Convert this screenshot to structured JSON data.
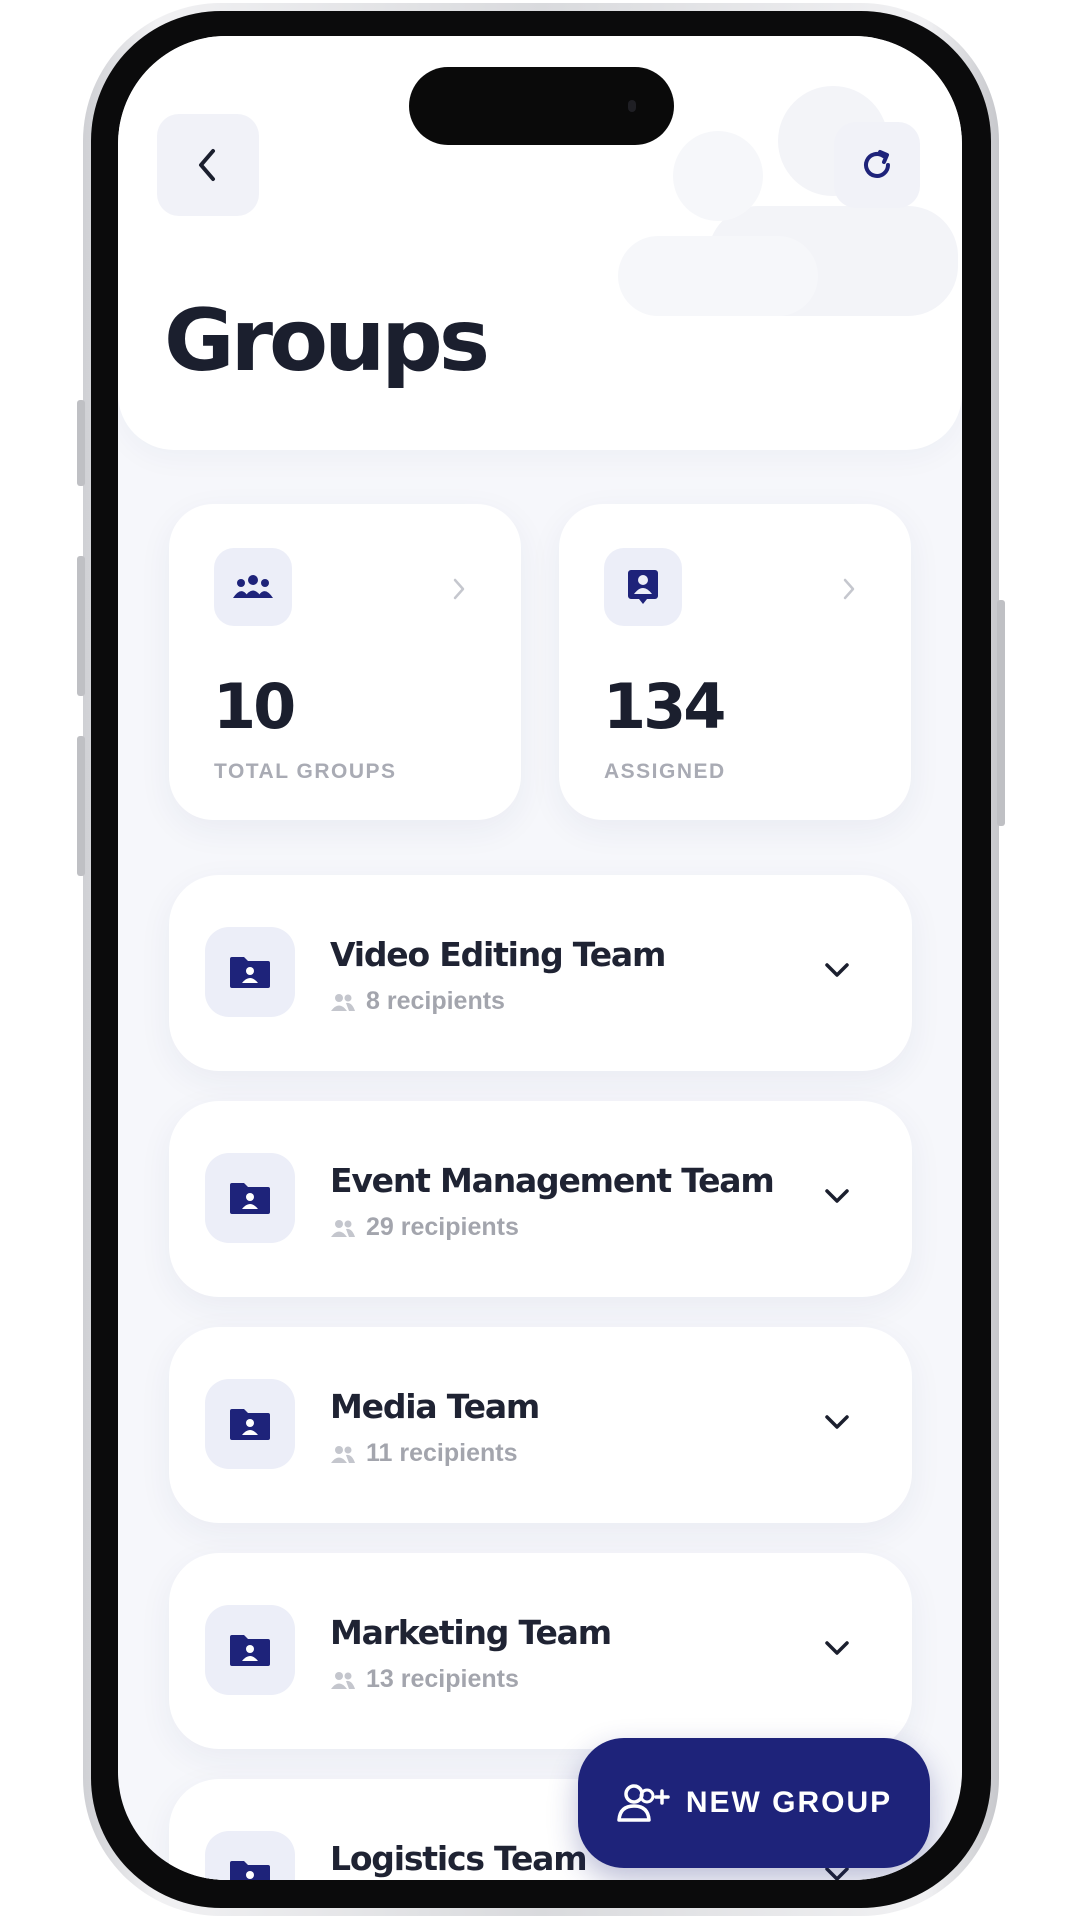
{
  "colors": {
    "accent": "#1e237a",
    "title": "#1b1f2e",
    "muted": "#a9abb4",
    "icon_bg": "#eceef8",
    "screen_bg": "#f6f7fb"
  },
  "header": {
    "title": "Groups",
    "back_icon": "chevron-left-icon",
    "refresh_icon": "refresh-icon"
  },
  "stats": [
    {
      "icon": "people-group-icon",
      "value": "10",
      "label": "TOTAL GROUPS"
    },
    {
      "icon": "contact-card-icon",
      "value": "134",
      "label": "ASSIGNED"
    }
  ],
  "groups": [
    {
      "name": "Video Editing Team",
      "recipients": "8 recipients"
    },
    {
      "name": "Event Management Team",
      "recipients": "29 recipients"
    },
    {
      "name": "Media Team",
      "recipients": "11 recipients"
    },
    {
      "name": "Marketing Team",
      "recipients": "13 recipients"
    },
    {
      "name": "Logistics Team",
      "recipients": ""
    }
  ],
  "fab": {
    "label": "NEW GROUP",
    "icon": "person-add-icon"
  }
}
